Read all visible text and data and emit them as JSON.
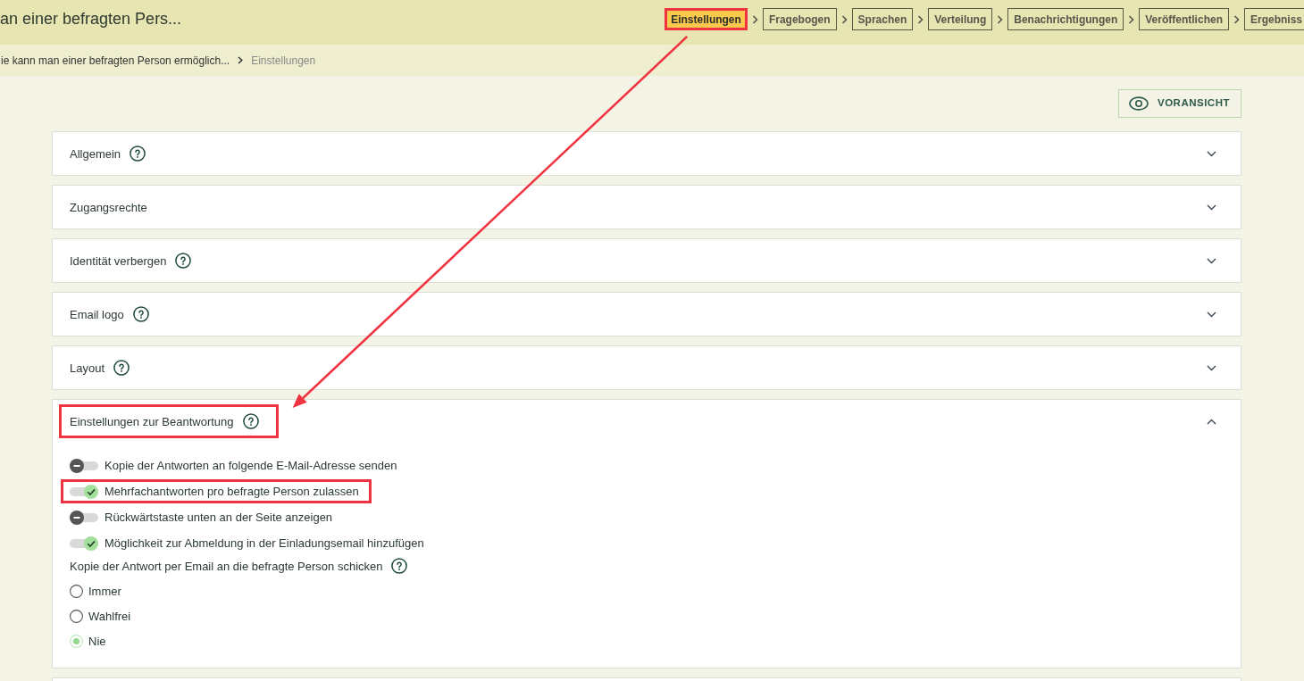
{
  "header": {
    "title": "an einer befragten Pers...",
    "steps": [
      {
        "label": "Einstellungen",
        "selected": true,
        "highlighted": true
      },
      {
        "label": "Fragebogen",
        "selected": false,
        "highlighted": false
      },
      {
        "label": "Sprachen",
        "selected": false,
        "highlighted": false
      },
      {
        "label": "Verteilung",
        "selected": false,
        "highlighted": false
      },
      {
        "label": "Benachrichtigungen",
        "selected": false,
        "highlighted": false
      },
      {
        "label": "Veröffentlichen",
        "selected": false,
        "highlighted": false
      },
      {
        "label": "Ergebniss",
        "selected": false,
        "highlighted": false
      }
    ]
  },
  "breadcrumb": [
    {
      "label": "ie kann man einer befragten Person ermöglich...",
      "current": false
    },
    {
      "label": "Einstellungen",
      "current": true
    }
  ],
  "preview_button": {
    "label": "VORANSICHT"
  },
  "panels": [
    {
      "title": "Allgemein",
      "help": true,
      "expanded": false,
      "highlighted": false
    },
    {
      "title": "Zugangsrechte",
      "help": false,
      "expanded": false,
      "highlighted": false
    },
    {
      "title": "Identität verbergen",
      "help": true,
      "expanded": false,
      "highlighted": false
    },
    {
      "title": "Email logo",
      "help": true,
      "expanded": false,
      "highlighted": false
    },
    {
      "title": "Layout",
      "help": true,
      "expanded": false,
      "highlighted": false
    },
    {
      "title": "Einstellungen zur Beantwortung",
      "help": true,
      "expanded": true,
      "highlighted": true,
      "toggles": [
        {
          "label": "Kopie der Antworten an folgende E-Mail-Adresse senden",
          "on": false,
          "highlighted": false
        },
        {
          "label": "Mehrfachantworten pro befragte Person zulassen",
          "on": true,
          "highlighted": true
        },
        {
          "label": "Rückwärtstaste unten an der Seite anzeigen",
          "on": false,
          "highlighted": false
        },
        {
          "label": "Möglichkeit zur Abmeldung in der Einladungsemail hinzufügen",
          "on": true,
          "highlighted": false
        }
      ],
      "radio_group": {
        "label": "Kopie der Antwort per Email an die befragte Person schicken",
        "help": true,
        "options": [
          {
            "label": "Immer",
            "selected": false
          },
          {
            "label": "Wahlfrei",
            "selected": false
          },
          {
            "label": "Nie",
            "selected": true
          }
        ]
      }
    }
  ],
  "annotations": [
    {
      "kind": "arrow"
    }
  ]
}
